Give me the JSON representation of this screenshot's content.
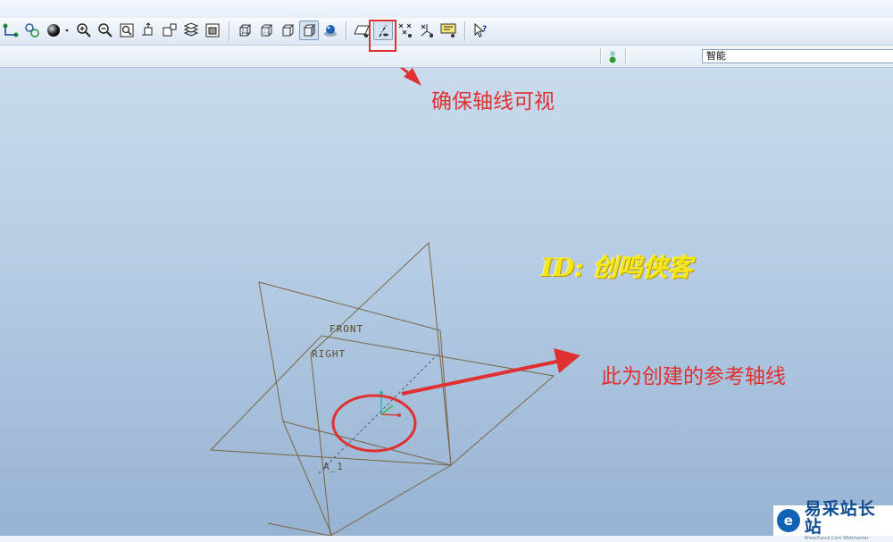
{
  "toolbar": {
    "buttons": [
      {
        "name": "datum-display-button",
        "icon": "datum-node-icon"
      },
      {
        "name": "repaint-button",
        "icon": "repaint-icon"
      },
      {
        "name": "display-style-button",
        "icon": "sphere-icon"
      },
      {
        "name": "zoom-in-button",
        "icon": "zoom-in-icon"
      },
      {
        "name": "zoom-out-button",
        "icon": "zoom-out-icon"
      },
      {
        "name": "refit-button",
        "icon": "refit-icon"
      },
      {
        "name": "reorient-button",
        "icon": "reorient-icon"
      },
      {
        "name": "saved-views-button",
        "icon": "saved-views-icon"
      },
      {
        "name": "layers-button",
        "icon": "layers-icon"
      },
      {
        "name": "view-manager-button",
        "icon": "view-manager-icon"
      },
      {
        "name": "wireframe-button",
        "icon": "wireframe-icon"
      },
      {
        "name": "hidden-line-button",
        "icon": "hidden-line-icon"
      },
      {
        "name": "no-hidden-button",
        "icon": "no-hidden-icon"
      },
      {
        "name": "shading-button",
        "icon": "shading-icon"
      },
      {
        "name": "enhanced-realism-button",
        "icon": "realism-icon"
      },
      {
        "name": "plane-display-button",
        "icon": "plane-display-icon"
      },
      {
        "name": "axis-display-button",
        "icon": "axis-display-icon"
      },
      {
        "name": "point-display-button",
        "icon": "point-display-icon"
      },
      {
        "name": "csys-display-button",
        "icon": "csys-display-icon"
      },
      {
        "name": "annotation-display-button",
        "icon": "annotation-display-icon"
      },
      {
        "name": "context-help-button",
        "icon": "context-help-icon"
      }
    ]
  },
  "status_bar": {
    "filter_value": "智能",
    "indicator_color": "#2e9b2e"
  },
  "annotations": {
    "ensure_axis_visible": "确保轴线可视",
    "reference_axis_note": "此为创建的参考轴线",
    "id_watermark": "ID: 创鸣侠客",
    "color": "#e03131"
  },
  "datums": {
    "front_label": "FRONT",
    "right_label": "RIGHT",
    "axis_label": "A_1",
    "line_color": "#7a6441"
  },
  "logo": {
    "mark": "e",
    "name_cn": "易采站长站",
    "name_en": "Www.Easck.Com Webmaster"
  }
}
